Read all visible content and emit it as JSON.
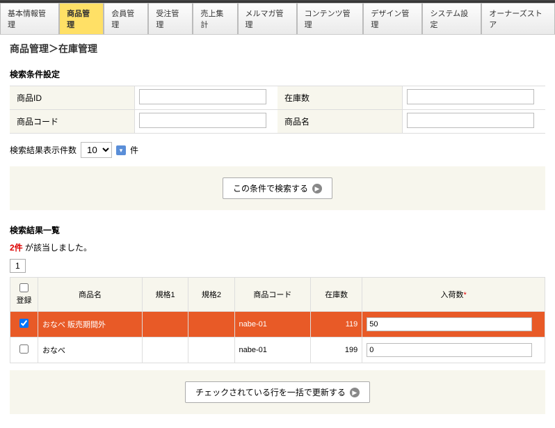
{
  "nav": {
    "tabs": [
      "基本情報管理",
      "商品管理",
      "会員管理",
      "受注管理",
      "売上集計",
      "メルマガ管理",
      "コンテンツ管理",
      "デザイン管理",
      "システム設定",
      "オーナーズストア"
    ],
    "active": 1
  },
  "breadcrumb": "商品管理＞在庫管理",
  "search": {
    "title": "検索条件設定",
    "fields": {
      "product_id_label": "商品ID",
      "stock_label": "在庫数",
      "product_code_label": "商品コード",
      "product_name_label": "商品名"
    },
    "display_count_label": "検索結果表示件数",
    "display_count_value": "10",
    "display_count_unit": "件",
    "submit_label": "この条件で検索する"
  },
  "results": {
    "title": "検索結果一覧",
    "count_num": "2件",
    "count_text": " が該当しました。",
    "page": "1",
    "headers": {
      "register": "登録",
      "name": "商品名",
      "spec1": "規格1",
      "spec2": "規格2",
      "code": "商品コード",
      "stock": "在庫数",
      "incoming": "入荷数"
    },
    "rows": [
      {
        "checked": true,
        "name": "おなべ 販売期間外",
        "spec1": "",
        "spec2": "",
        "code": "nabe-01",
        "stock": "119",
        "incoming": "50",
        "selected": true
      },
      {
        "checked": false,
        "name": "おなべ",
        "spec1": "",
        "spec2": "",
        "code": "nabe-01",
        "stock": "199",
        "incoming": "0",
        "selected": false
      }
    ],
    "update_label": "チェックされている行を一括で更新する"
  }
}
